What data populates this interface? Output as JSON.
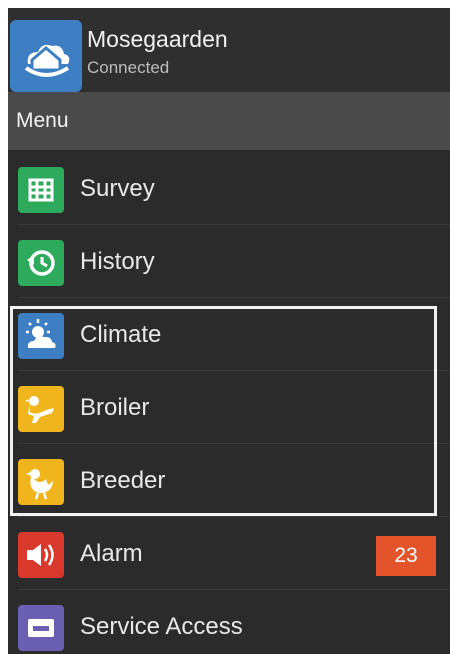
{
  "header": {
    "title": "Mosegaarden",
    "status": "Connected",
    "logo_icon": "cloud-house-icon",
    "logo_color": "#3d7fc2"
  },
  "menu": {
    "label": "Menu",
    "items": [
      {
        "label": "Survey",
        "icon": "grid-icon",
        "color": "#2eaa5c"
      },
      {
        "label": "History",
        "icon": "history-clock-icon",
        "color": "#2eaa5c"
      },
      {
        "label": "Climate",
        "icon": "sun-cloud-icon",
        "color": "#3d7fc2"
      },
      {
        "label": "Broiler",
        "icon": "chicken-icon",
        "color": "#f0b51c"
      },
      {
        "label": "Breeder",
        "icon": "hen-icon",
        "color": "#f0b51c"
      },
      {
        "label": "Alarm",
        "icon": "speaker-icon",
        "color": "#d8392c",
        "badge": "23",
        "badge_color": "#e4542a"
      },
      {
        "label": "Service Access",
        "icon": "service-card-icon",
        "color": "#6a5fb0"
      }
    ]
  }
}
